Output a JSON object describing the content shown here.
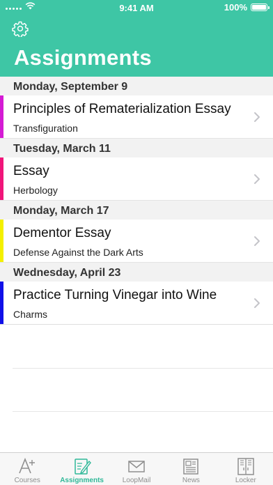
{
  "status_bar": {
    "time": "9:41 AM",
    "battery": "100%"
  },
  "header": {
    "title": "Assignments",
    "settings_icon": "gear-icon"
  },
  "colors": {
    "accent": "#3ec6a5",
    "tab_active": "#2fb898"
  },
  "sections": [
    {
      "date": "Monday, September 9",
      "items": [
        {
          "title": "Principles of Rematerialization Essay",
          "course": "Transfiguration",
          "color": "#d41bd4"
        }
      ]
    },
    {
      "date": "Tuesday, March 11",
      "items": [
        {
          "title": "Essay",
          "course": "Herbology",
          "color": "#f0157a"
        }
      ]
    },
    {
      "date": "Monday, March 17",
      "items": [
        {
          "title": "Dementor Essay",
          "course": "Defense Against the Dark Arts",
          "color": "#f4f000"
        }
      ]
    },
    {
      "date": "Wednesday, April 23",
      "items": [
        {
          "title": "Practice Turning Vinegar into Wine",
          "course": "Charms",
          "color": "#1010e8"
        }
      ]
    }
  ],
  "tabs": [
    {
      "label": "Courses",
      "icon": "courses-icon",
      "active": false
    },
    {
      "label": "Assignments",
      "icon": "assignments-icon",
      "active": true
    },
    {
      "label": "LoopMail",
      "icon": "mail-icon",
      "active": false
    },
    {
      "label": "News",
      "icon": "news-icon",
      "active": false
    },
    {
      "label": "Locker",
      "icon": "locker-icon",
      "active": false
    }
  ]
}
